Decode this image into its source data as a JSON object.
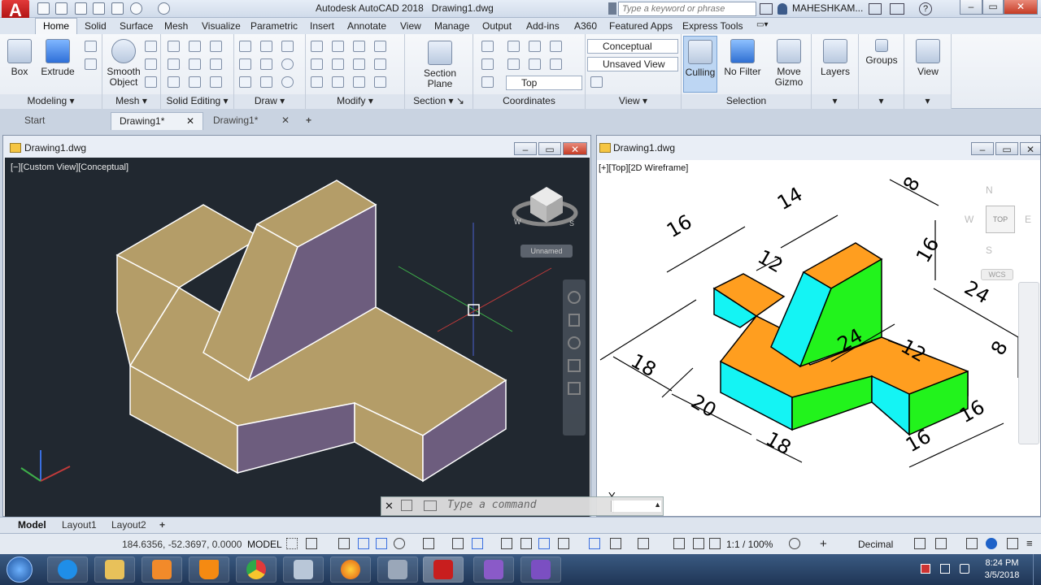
{
  "titlebar": {
    "app_title": "Autodesk AutoCAD 2018",
    "file_title": "Drawing1.dwg",
    "search_placeholder": "Type a keyword or phrase",
    "user": "MAHESHKAM..."
  },
  "tabs": [
    "Home",
    "Solid",
    "Surface",
    "Mesh",
    "Visualize",
    "Parametric",
    "Insert",
    "Annotate",
    "View",
    "Manage",
    "Output",
    "Add-ins",
    "A360",
    "Featured Apps",
    "Express Tools"
  ],
  "ribbon": {
    "box": "Box",
    "extrude": "Extrude",
    "smooth": "Smooth\nObject",
    "section_plane": "Section\nPlane",
    "visual_style": "Conceptual",
    "view_state": "Unsaved View",
    "view_dir": "Top",
    "culling": "Culling",
    "no_filter": "No Filter",
    "move_gizmo": "Move\nGizmo",
    "layers": "Layers",
    "groups": "Groups",
    "view": "View",
    "panels": [
      "Modeling",
      "Mesh",
      "Solid Editing",
      "Draw",
      "Modify",
      "Section",
      "Coordinates",
      "View",
      "Selection"
    ]
  },
  "doctabs": [
    "Start",
    "Drawing1*",
    "Drawing1*"
  ],
  "viewports": {
    "left_title": "Drawing1.dwg",
    "left_label": "[−][Custom View][Conceptual]",
    "left_view_name": "Unnamed",
    "right_title": "Drawing1.dwg",
    "right_label": "[+][Top][2D Wireframe]",
    "compass": {
      "n": "N",
      "s": "S",
      "e": "E",
      "w": "W",
      "top": "TOP",
      "wcs": "WCS"
    },
    "dims": [
      "16",
      "14",
      "8",
      "16",
      "12",
      "24",
      "8",
      "24",
      "12",
      "18",
      "20",
      "18",
      "16",
      "16"
    ]
  },
  "cmdline": {
    "placeholder": "Type a command"
  },
  "layout_tabs": [
    "Model",
    "Layout1",
    "Layout2"
  ],
  "status": {
    "coords": "184.6356, -52.3697, 0.0000",
    "mode": "MODEL",
    "scale": "1:1 / 100%",
    "units": "Decimal"
  },
  "clock": {
    "time": "8:24 PM",
    "date": "3/5/2018"
  },
  "colors": {
    "tan": "#b49d68",
    "purple": "#6d5d7e",
    "orange": "#ff9e1f",
    "cyan": "#14f4f4",
    "green": "#22f31c"
  }
}
